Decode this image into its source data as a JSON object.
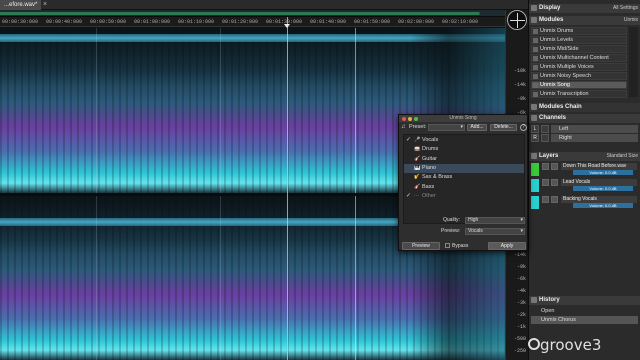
{
  "tab": {
    "file_name": "...efore.wav*",
    "close": "×"
  },
  "ruler": {
    "ticks": [
      "00:00:30:000",
      "00:00:40:000",
      "00:00:50:000",
      "00:01:00:000",
      "00:01:10:000",
      "00:01:20:000",
      "00:01:30:000",
      "00:01:40:000",
      "00:01:50:000",
      "00:02:00:000",
      "00:02:10:000"
    ]
  },
  "frequency_scale": [
    "-10k",
    "-14k",
    "-9k",
    "-6k",
    "-4k",
    "-3k",
    "-2k",
    "-1k",
    "-500",
    "-250",
    "-14k",
    "-9k",
    "-6k",
    "-4k",
    "-3k",
    "-2k",
    "-1k",
    "-500",
    "-250"
  ],
  "panel": {
    "display": {
      "title": "Display",
      "option": "All Settings"
    },
    "modules": {
      "title": "Modules",
      "option": "Unmix",
      "items": [
        "Unmix Drums",
        "Unmix Levels",
        "Unmix Mid/Side",
        "Unmix Multichannel Content",
        "Unmix Multiple Voices",
        "Unmix Noisy Speech",
        "Unmix Song",
        "Unmix Transcription"
      ],
      "active": "Unmix Song",
      "chain": "Modules Chain"
    },
    "channels": {
      "title": "Channels",
      "items": [
        {
          "tag": "L",
          "label": "Left"
        },
        {
          "tag": "R",
          "label": "Right"
        }
      ]
    },
    "layers": {
      "title": "Layers",
      "option": "Standard Size",
      "items": [
        {
          "name": "Down This Road Before.wav",
          "volume": "Volume: 0.0 dB",
          "color": "#3acb3a"
        },
        {
          "name": "Lead Vocals",
          "volume": "Volume: 0.0 dB",
          "color": "#2bd0d0"
        },
        {
          "name": "Backing Vocals",
          "volume": "Volume: 0.0 dB",
          "color": "#2bd0d0"
        }
      ]
    },
    "history": {
      "title": "History",
      "items": [
        "Open",
        "Unmix Chorus"
      ]
    }
  },
  "dialog": {
    "title": "Unmix Song",
    "preset_label": "Preset:",
    "preset_value": "",
    "add": "Add...",
    "delete": "Delete...",
    "help": "?",
    "stems": [
      {
        "label": "Vocals",
        "checked": true,
        "icon": "🎤"
      },
      {
        "label": "Drums",
        "checked": false,
        "icon": "🥁"
      },
      {
        "label": "Guitar",
        "checked": false,
        "icon": "🎸"
      },
      {
        "label": "Piano",
        "checked": false,
        "icon": "🎹"
      },
      {
        "label": "Sax & Brass",
        "checked": false,
        "icon": "🎷"
      },
      {
        "label": "Bass",
        "checked": false,
        "icon": "🎸"
      },
      {
        "label": "Other",
        "checked": true,
        "icon": "⋯"
      }
    ],
    "quality_label": "Quality:",
    "quality_value": "High",
    "preview_label": "Preview:",
    "preview_value": "Vocals",
    "preview_btn": "Preview",
    "bypass": "Bypass",
    "apply": "Apply"
  },
  "watermark": "groove3",
  "colors": {
    "accent": "#2d6f9d",
    "wave_green": "#2e8f5b",
    "spectrogram_cyan": "#2ec5d6"
  }
}
